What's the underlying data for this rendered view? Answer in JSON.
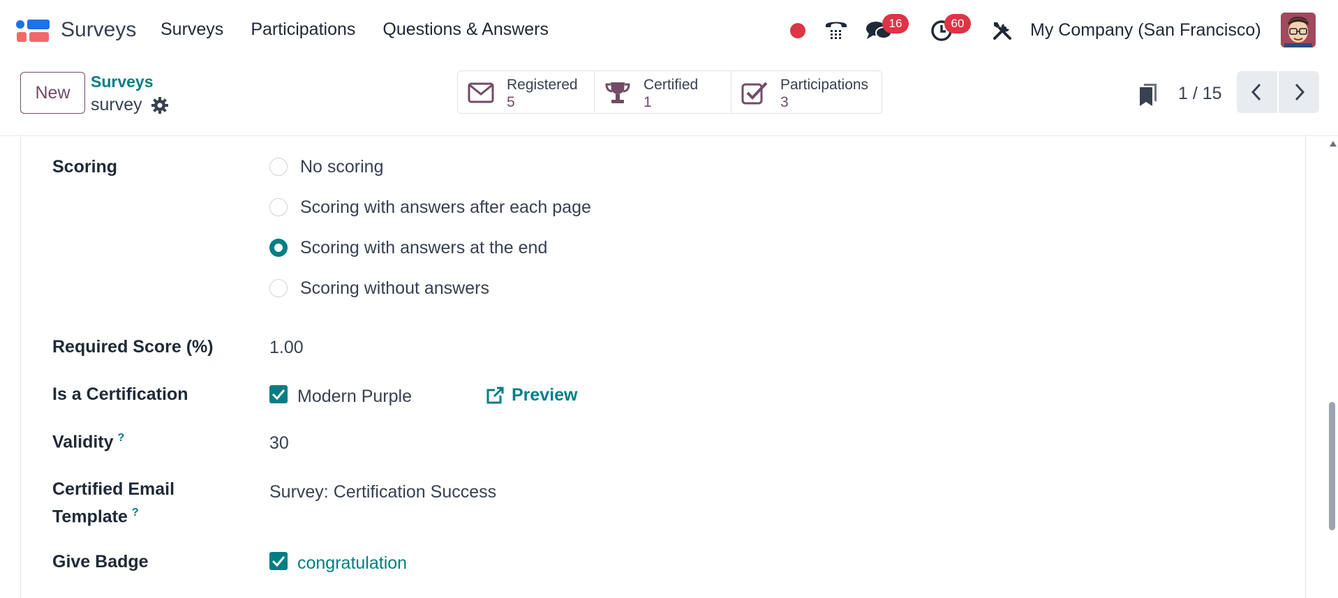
{
  "app": {
    "name": "Surveys"
  },
  "menu": [
    "Surveys",
    "Participations",
    "Questions & Answers"
  ],
  "systray": {
    "messages_count": "16",
    "activities_count": "60",
    "company": "My Company (San Francisco)"
  },
  "control": {
    "new_label": "New",
    "breadcrumb_parent": "Surveys",
    "breadcrumb_current": "survey",
    "stats": [
      {
        "label": "Registered",
        "value": "5",
        "icon": "envelope-icon"
      },
      {
        "label": "Certified",
        "value": "1",
        "icon": "trophy-icon"
      },
      {
        "label": "Participations",
        "value": "3",
        "icon": "check-square-icon"
      }
    ],
    "pager": "1 / 15"
  },
  "form": {
    "scoring_label": "Scoring",
    "scoring_options": [
      {
        "label": "No scoring",
        "checked": false
      },
      {
        "label": "Scoring with answers after each page",
        "checked": false
      },
      {
        "label": "Scoring with answers at the end",
        "checked": true
      },
      {
        "label": "Scoring without answers",
        "checked": false
      }
    ],
    "required_score_label": "Required Score (%)",
    "required_score_value": "1.00",
    "certification_label": "Is a Certification",
    "certification_template": "Modern Purple",
    "preview_label": "Preview",
    "validity_label": "Validity",
    "help_mark": "?",
    "validity_value": "30",
    "certified_email_label_line1": "Certified Email",
    "certified_email_label_line2": "Template",
    "certified_email_value": "Survey: Certification Success",
    "give_badge_label": "Give Badge",
    "badge_value": "congratulation"
  },
  "colors": {
    "brand": "#714b67",
    "accent": "#017e84",
    "badge": "#dc3545"
  }
}
